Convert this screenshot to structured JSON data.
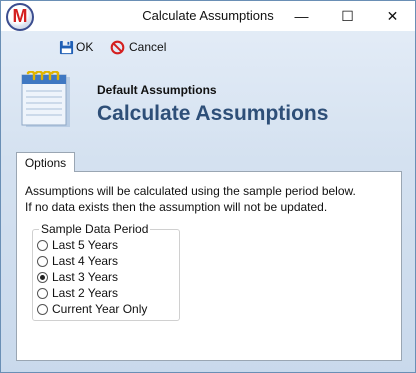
{
  "window": {
    "title": "Calculate Assumptions",
    "app_icon_letter": "M",
    "controls": {
      "minimize": "—",
      "maximize": "☐",
      "close": "✕"
    }
  },
  "toolbar": {
    "ok_label": "OK",
    "cancel_label": "Cancel"
  },
  "header": {
    "subtitle": "Default Assumptions",
    "title": "Calculate Assumptions"
  },
  "tabs": [
    {
      "label": "Options",
      "active": true
    }
  ],
  "options": {
    "description_line1": "Assumptions will be calculated using the sample period below.",
    "description_line2": "If no data exists then the assumption will not be updated.",
    "group_label": "Sample Data Period",
    "radios": [
      {
        "label": "Last 5 Years",
        "checked": false
      },
      {
        "label": "Last 4 Years",
        "checked": false
      },
      {
        "label": "Last 3 Years",
        "checked": true
      },
      {
        "label": "Last 2 Years",
        "checked": false
      },
      {
        "label": "Current Year Only",
        "checked": false
      }
    ]
  },
  "colors": {
    "title_blue": "#2e4f78",
    "cancel_red": "#d42020",
    "save_blue": "#1f5fb5"
  }
}
